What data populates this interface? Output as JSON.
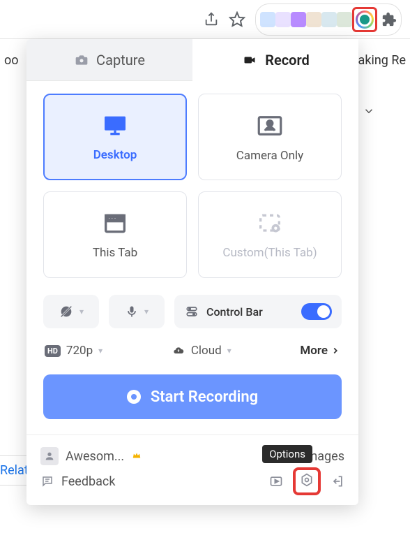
{
  "bg": {
    "left": "oo",
    "right": "aking Re",
    "relat": "Relat",
    "mages": "mages"
  },
  "tabs": {
    "capture": "Capture",
    "record": "Record"
  },
  "cards": {
    "desktop": "Desktop",
    "camera": "Camera Only",
    "tab": "This Tab",
    "custom": "Custom(This Tab)"
  },
  "control_bar": "Control Bar",
  "quality": "720p",
  "storage": "Cloud",
  "more": "More",
  "start": "Start Recording",
  "user": {
    "name": "Awesom..."
  },
  "feedback": "Feedback",
  "tooltip": "Options"
}
